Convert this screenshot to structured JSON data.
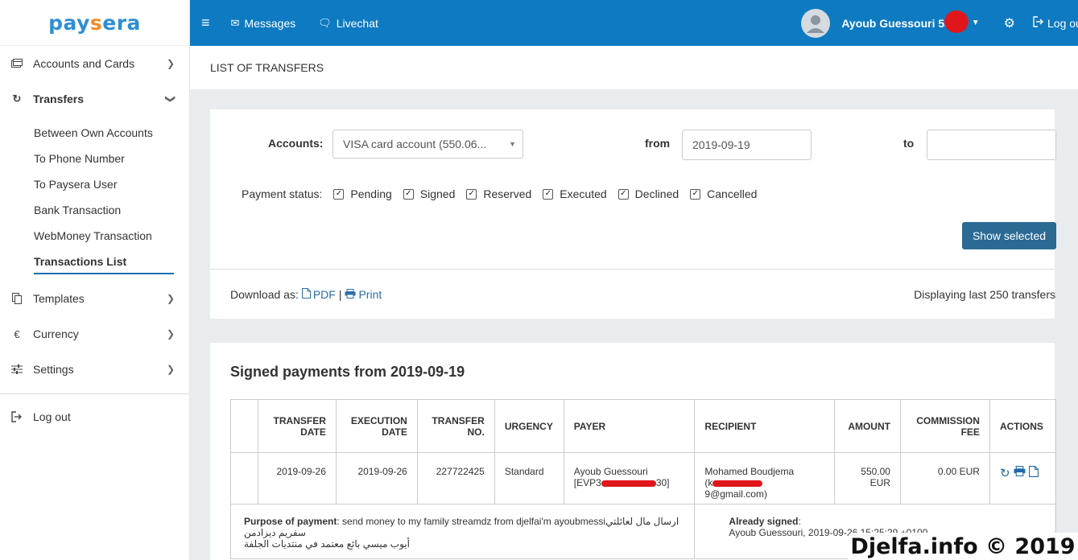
{
  "brand": {
    "name_left": "pay",
    "name_s": "s",
    "name_right": "era"
  },
  "sidebar": {
    "items": [
      {
        "label": "Accounts and Cards"
      },
      {
        "label": "Transfers"
      },
      {
        "label": "Templates"
      },
      {
        "label": "Currency"
      },
      {
        "label": "Settings"
      },
      {
        "label": "Log out"
      }
    ],
    "sub_items": [
      {
        "label": "Between Own Accounts"
      },
      {
        "label": "To Phone Number"
      },
      {
        "label": "To Paysera User"
      },
      {
        "label": "Bank Transaction"
      },
      {
        "label": "WebMoney Transaction"
      },
      {
        "label": "Transactions List"
      }
    ]
  },
  "topbar": {
    "messages": "Messages",
    "livechat": "Livechat",
    "user": "Ayoub Guessouri 539",
    "logout": "Log out"
  },
  "page_title": "LIST OF TRANSFERS",
  "filters": {
    "accounts_label": "Accounts:",
    "account_value": "VISA card account (550.06...",
    "from_label": "from",
    "from_value": "2019-09-19",
    "to_label": "to",
    "to_value": "",
    "status_label": "Payment status:",
    "statuses": [
      "Pending",
      "Signed",
      "Reserved",
      "Executed",
      "Declined",
      "Cancelled"
    ],
    "show_button": "Show selected"
  },
  "download": {
    "label": "Download as:",
    "pdf": "PDF",
    "separator": "|",
    "print": "Print",
    "count_text": "Displaying last 250 transfers"
  },
  "results": {
    "title": "Signed payments from 2019-09-19",
    "columns": {
      "transfer_date_1": "TRANSFER",
      "transfer_date_2": "DATE",
      "execution_date_1": "EXECUTION",
      "execution_date_2": "DATE",
      "transfer_no_1": "TRANSFER",
      "transfer_no_2": "NO.",
      "urgency": "URGENCY",
      "payer": "PAYER",
      "recipient": "RECIPIENT",
      "amount": "AMOUNT",
      "commission_1": "COMMISSION",
      "commission_2": "FEE",
      "actions": "ACTIONS"
    },
    "row": {
      "transfer_date": "2019-09-26",
      "execution_date": "2019-09-26",
      "transfer_no": "227722425",
      "urgency": "Standard",
      "payer_name": "Ayoub Guessouri",
      "payer_account_start": "[EVP3",
      "payer_account_end": "30]",
      "recipient_name": "Mohamed Boudjema",
      "recipient_email_start": "(k",
      "recipient_email_end": "9@gmail.com)",
      "amount_value": "550.00",
      "amount_currency": "EUR",
      "fee": "0.00 EUR"
    },
    "purpose": {
      "label": "Purpose of payment",
      "text": ": send money to my family streamdz from djelfai'm ayoubmessi",
      "arabic_1": "ارسال مال لعائلتي سفريم ديزادمن",
      "arabic_2": "أيوب ميسي بائع معتمد في منتديات الجلفة",
      "signed_label": "Already signed",
      "signed_colon": ":",
      "signed_value": "Ayoub Guessouri, 2019-09-26 15:25:29 +0100"
    }
  },
  "watermark": "Djelfa.info © 2019",
  "colors": {
    "topbar": "#0d7ac2",
    "button": "#2b6a93",
    "link": "#2b6fa8",
    "redaction": "#e0161b"
  }
}
